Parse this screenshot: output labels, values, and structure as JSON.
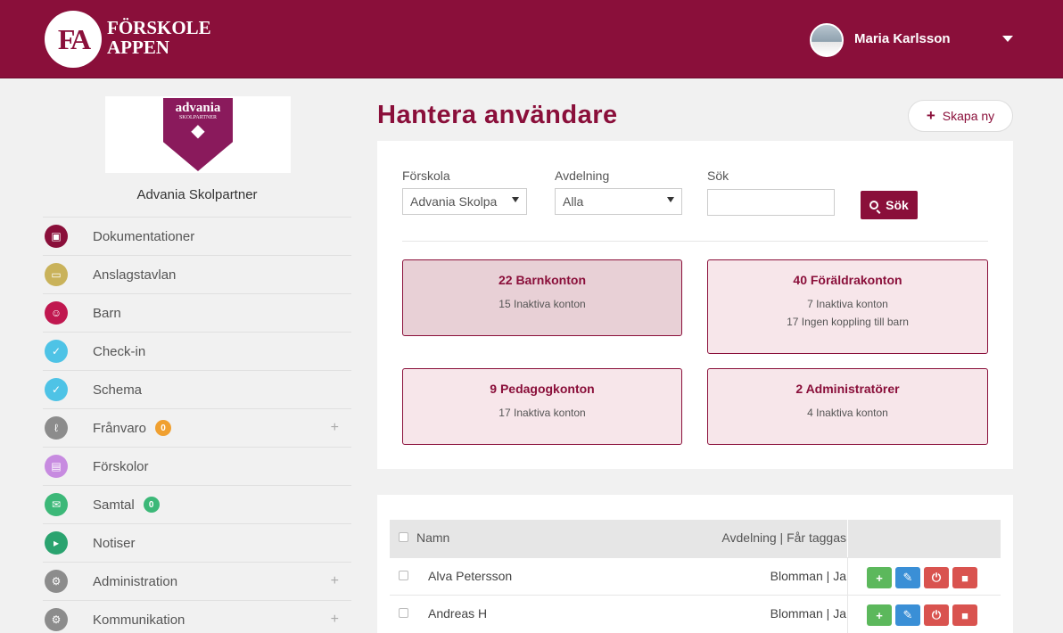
{
  "header": {
    "logo_mark": "FA",
    "logo_line1": "FÖRSKOLE",
    "logo_line2": "APPEN",
    "user_name": "Maria Karlsson"
  },
  "sidebar": {
    "org_logo_line1": "advania",
    "org_logo_line2": "SKOLPARTNER",
    "org_name": "Advania Skolpartner",
    "items": [
      {
        "label": "Dokumentationer",
        "icon": "image-icon",
        "color": "#8a0f3a"
      },
      {
        "label": "Anslagstavlan",
        "icon": "monitor-icon",
        "color": "#c9b25a"
      },
      {
        "label": "Barn",
        "icon": "smiley-icon",
        "color": "#c0174f"
      },
      {
        "label": "Check-in",
        "icon": "check-icon",
        "color": "#4ec3e6"
      },
      {
        "label": "Schema",
        "icon": "check-icon",
        "color": "#4ec3e6"
      },
      {
        "label": "Frånvaro",
        "icon": "thermometer-icon",
        "color": "#8c8c8c",
        "badge": "0",
        "badge_color": "#f0a030"
      },
      {
        "label": "Förskolor",
        "icon": "book-icon",
        "color": "#c78be0"
      },
      {
        "label": "Samtal",
        "icon": "envelope-icon",
        "color": "#3cb878",
        "badge": "0",
        "badge_color": "#3cb878"
      },
      {
        "label": "Notiser",
        "icon": "megaphone-icon",
        "color": "#2aa36f"
      },
      {
        "label": "Administration",
        "icon": "gear-icon",
        "color": "#8c8c8c"
      },
      {
        "label": "Kommunikation",
        "icon": "gear-icon",
        "color": "#8c8c8c"
      }
    ]
  },
  "main": {
    "title": "Hantera användare",
    "create_label": "Skapa ny",
    "filters": {
      "school_label": "Förskola",
      "school_value": "Advania Skolpa",
      "dept_label": "Avdelning",
      "dept_value": "Alla",
      "search_label": "Sök",
      "search_value": "",
      "search_button": "Sök"
    },
    "stats": [
      {
        "title": "22 Barnkonton",
        "lines": [
          "15 Inaktiva konton"
        ]
      },
      {
        "title": "40 Föräldrakonton",
        "lines": [
          "7 Inaktiva konton",
          "17 Ingen koppling till barn"
        ]
      },
      {
        "title": "9 Pedagogkonton",
        "lines": [
          "17 Inaktiva konton"
        ]
      },
      {
        "title": "2 Administratörer",
        "lines": [
          "4 Inaktiva konton"
        ]
      }
    ],
    "table": {
      "col_name": "Namn",
      "col_avd": "Avdelning | Får taggas",
      "rows": [
        {
          "name": "Alva Petersson",
          "avd": "Blomman | Ja"
        },
        {
          "name": "Andreas H",
          "avd": "Blomman | Ja"
        }
      ]
    }
  },
  "colors": {
    "brand": "#8a0f3a",
    "add": "#5cb85c",
    "edit": "#3a8fd6",
    "danger": "#d9534f"
  }
}
